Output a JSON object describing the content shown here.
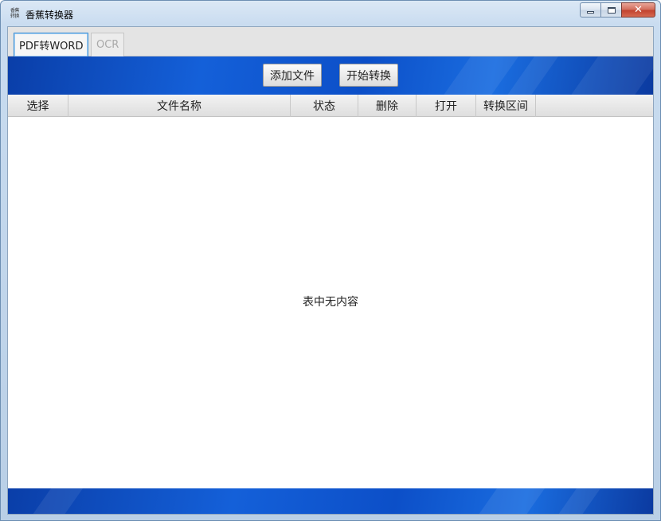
{
  "window": {
    "title": "香蕉转换器",
    "icon_line1": "香蕉",
    "icon_line2": "转换",
    "minimize_icon": "minimize-icon",
    "maximize_icon": "maximize-icon",
    "close_label": "✕"
  },
  "tabs": [
    {
      "label": "PDF转WORD",
      "active": true
    },
    {
      "label": "OCR",
      "active": false
    }
  ],
  "toolbar": {
    "add_file_label": "添加文件",
    "start_convert_label": "开始转换"
  },
  "table": {
    "columns": [
      "选择",
      "文件名称",
      "状态",
      "删除",
      "打开",
      "转换区间"
    ],
    "empty_text": "表中无内容"
  },
  "colors": {
    "banner_blue": "#1460d9",
    "tab_focus": "#3c8fd6",
    "close_red": "#c2432f"
  }
}
